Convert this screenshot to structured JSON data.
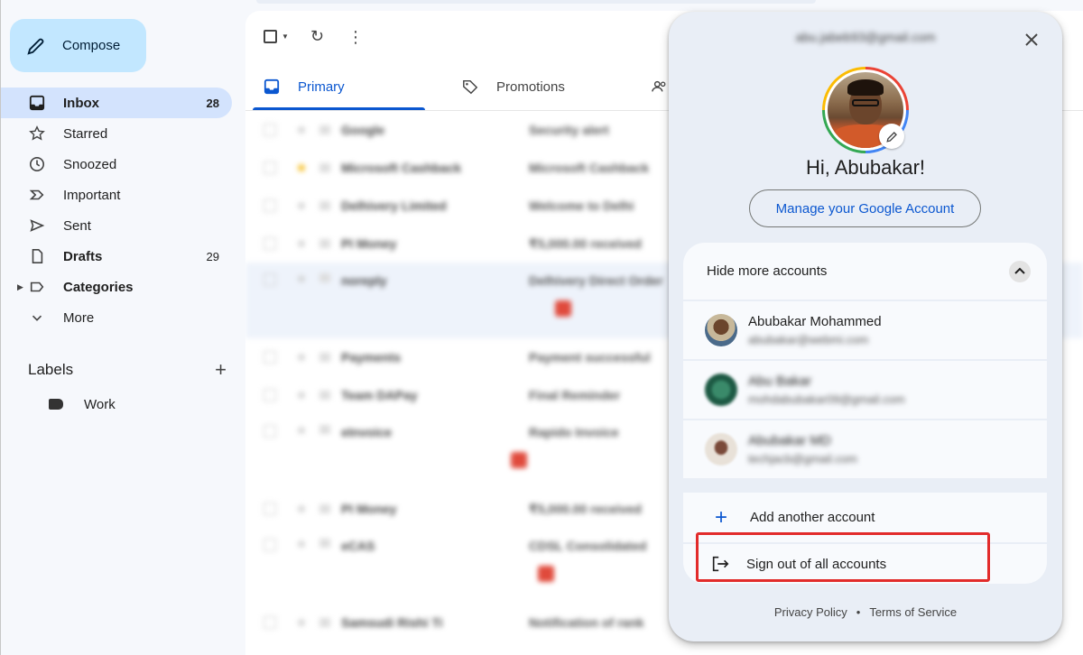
{
  "sidebar": {
    "compose_label": "Compose",
    "items": [
      {
        "label": "Inbox",
        "count": "28"
      },
      {
        "label": "Starred",
        "count": ""
      },
      {
        "label": "Snoozed",
        "count": ""
      },
      {
        "label": "Important",
        "count": ""
      },
      {
        "label": "Sent",
        "count": ""
      },
      {
        "label": "Drafts",
        "count": "29"
      },
      {
        "label": "Categories",
        "count": ""
      },
      {
        "label": "More",
        "count": ""
      }
    ],
    "labels_heading": "Labels",
    "labels": [
      {
        "label": "Work"
      }
    ]
  },
  "main": {
    "tabs": [
      {
        "label": "Primary"
      },
      {
        "label": "Promotions"
      }
    ],
    "rows": [
      {
        "from": "Google",
        "subject": "Security alert"
      },
      {
        "from": "Microsoft Cashback",
        "subject": "Microsoft Cashback"
      },
      {
        "from": "Delhivery Limited",
        "subject": "Welcome to Delhi"
      },
      {
        "from": "PI Money",
        "subject": "₹5,000.00 received"
      },
      {
        "from": "noreply",
        "subject": "Delhivery Direct Order"
      },
      {
        "from": "Payments",
        "subject": "Payment successful"
      },
      {
        "from": "Team DAPay",
        "subject": "Final Reminder"
      },
      {
        "from": "eInvoice",
        "subject": "Rapido Invoice"
      },
      {
        "from": "PI Money",
        "subject": "₹5,000.00 received"
      },
      {
        "from": "eCAS",
        "subject": "CDSL Consolidated"
      },
      {
        "from": "Samsudi Rishi Ti",
        "subject": "Notification of rank"
      }
    ]
  },
  "account_popup": {
    "email": "abu.jabeb93@gmail.com",
    "greeting": "Hi, Abubakar!",
    "manage_label": "Manage your Google Account",
    "hide_more_label": "Hide more accounts",
    "accounts": [
      {
        "name": "Abubakar Mohammed",
        "email": "abubakar@webmi.com"
      },
      {
        "name": "Abu Bakar",
        "email": "mohdabubakar09@gmail.com"
      },
      {
        "name": "Abubakar MD",
        "email": "techjacb@gmail.com"
      }
    ],
    "add_account_label": "Add another account",
    "sign_out_label": "Sign out of all accounts",
    "privacy_label": "Privacy Policy",
    "dot": "•",
    "terms_label": "Terms of Service"
  },
  "colors": {
    "accent": "#0b57d0",
    "compose_bg": "#c2e7ff",
    "inbox_active_bg": "#d3e3fd",
    "highlight": "#e22b2b"
  }
}
